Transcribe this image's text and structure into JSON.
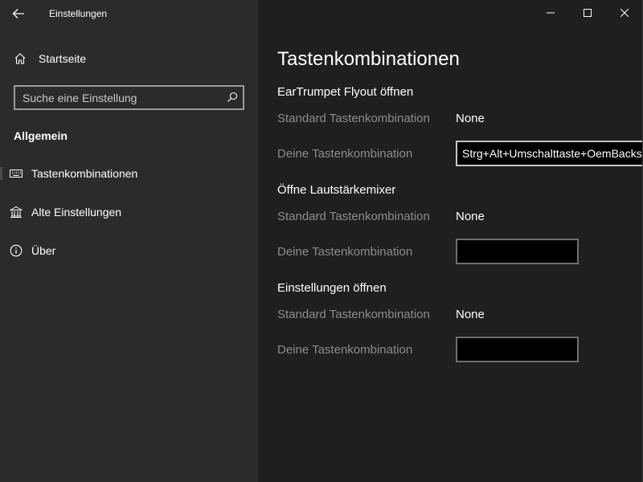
{
  "window": {
    "title": "Einstellungen"
  },
  "sidebar": {
    "home_label": "Startseite",
    "search_placeholder": "Suche eine Einstellung",
    "section_label": "Allgemein",
    "items": [
      {
        "label": "Tastenkombinationen",
        "icon": "keyboard-icon",
        "selected": true
      },
      {
        "label": "Alte Einstellungen",
        "icon": "bank-icon",
        "selected": false
      },
      {
        "label": "Über",
        "icon": "info-icon",
        "selected": false
      }
    ]
  },
  "content": {
    "title": "Tastenkombinationen",
    "groups": [
      {
        "title": "EarTrumpet Flyout öffnen",
        "default_label": "Standard Tastenkombination",
        "default_value": "None",
        "custom_label": "Deine Tastenkombination",
        "custom_value": "Strg+Alt+Umschalttaste+OemBackslash"
      },
      {
        "title": "Öffne Lautstärkemixer",
        "default_label": "Standard Tastenkombination",
        "default_value": "None",
        "custom_label": "Deine Tastenkombination",
        "custom_value": ""
      },
      {
        "title": "Einstellungen öffnen",
        "default_label": "Standard Tastenkombination",
        "default_value": "None",
        "custom_label": "Deine Tastenkombination",
        "custom_value": ""
      }
    ]
  },
  "colors": {
    "sidebar_bg": "#2b2b2b",
    "content_bg": "#1f1f1f",
    "label_gray": "#8c8c8c",
    "text": "#ffffff"
  }
}
